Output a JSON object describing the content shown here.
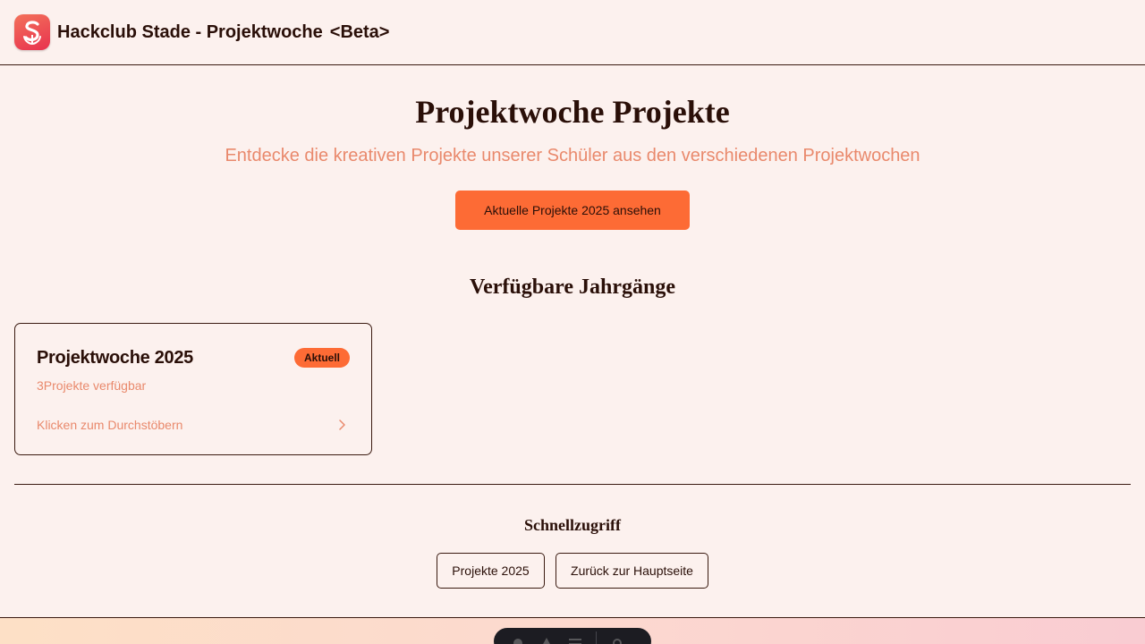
{
  "header": {
    "title": "Hackclub Stade - Projektwoche",
    "badge": "<Beta>",
    "logo_icon": "s-anchor-logo"
  },
  "hero": {
    "title": "Projektwoche Projekte",
    "subtitle": "Entdecke die kreativen Projekte unserer Schüler aus den verschiedenen Projektwochen",
    "cta_label": "Aktuelle Projekte 2025 ansehen"
  },
  "years": {
    "section_title": "Verfügbare Jahrgänge",
    "cards": [
      {
        "title": "Projektwoche 2025",
        "badge": "Aktuell",
        "count": "3Projekte verfügbar",
        "link": "Klicken zum Durchstöbern",
        "chevron_icon": "chevron-right-icon"
      }
    ]
  },
  "quick": {
    "title": "Schnellzugriff",
    "buttons": [
      "Projekte 2025",
      "Zurück zur Hauptseite"
    ]
  },
  "colors": {
    "background": "#fcf1ee",
    "accent": "#fd6b35",
    "muted_text": "#e9896c",
    "text": "#2a0f08"
  }
}
